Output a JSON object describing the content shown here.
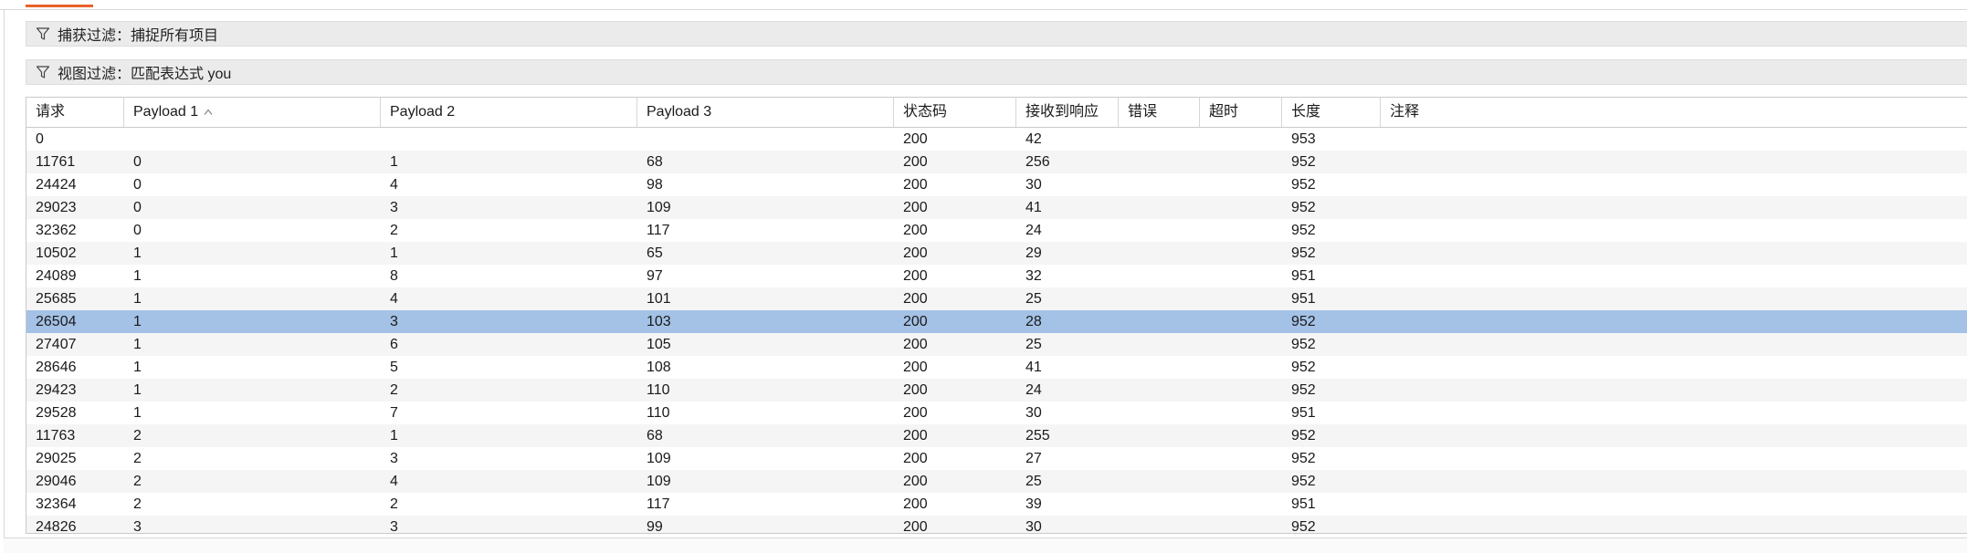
{
  "capture_filter": {
    "label": "捕获过滤：",
    "value": "捕捉所有项目"
  },
  "view_filter": {
    "label": "视图过滤：",
    "value": "匹配表达式 you"
  },
  "table": {
    "headers": [
      "请求",
      "Payload 1",
      "Payload 2",
      "Payload 3",
      "状态码",
      "接收到响应",
      "错误",
      "超时",
      "长度",
      "注释"
    ],
    "sorted_column": "Payload 1",
    "sort_direction": "ascending",
    "selected_row": 8,
    "selection_color": "#a4c1e6",
    "rows": [
      [
        "0",
        "",
        "",
        "",
        "200",
        "42",
        "",
        "",
        "953",
        ""
      ],
      [
        "11761",
        "0",
        "1",
        "68",
        "200",
        "256",
        "",
        "",
        "952",
        ""
      ],
      [
        "24424",
        "0",
        "4",
        "98",
        "200",
        "30",
        "",
        "",
        "952",
        ""
      ],
      [
        "29023",
        "0",
        "3",
        "109",
        "200",
        "41",
        "",
        "",
        "952",
        ""
      ],
      [
        "32362",
        "0",
        "2",
        "117",
        "200",
        "24",
        "",
        "",
        "952",
        ""
      ],
      [
        "10502",
        "1",
        "1",
        "65",
        "200",
        "29",
        "",
        "",
        "952",
        ""
      ],
      [
        "24089",
        "1",
        "8",
        "97",
        "200",
        "32",
        "",
        "",
        "951",
        ""
      ],
      [
        "25685",
        "1",
        "4",
        "101",
        "200",
        "25",
        "",
        "",
        "951",
        ""
      ],
      [
        "26504",
        "1",
        "3",
        "103",
        "200",
        "28",
        "",
        "",
        "952",
        ""
      ],
      [
        "27407",
        "1",
        "6",
        "105",
        "200",
        "25",
        "",
        "",
        "952",
        ""
      ],
      [
        "28646",
        "1",
        "5",
        "108",
        "200",
        "41",
        "",
        "",
        "952",
        ""
      ],
      [
        "29423",
        "1",
        "2",
        "110",
        "200",
        "24",
        "",
        "",
        "952",
        ""
      ],
      [
        "29528",
        "1",
        "7",
        "110",
        "200",
        "30",
        "",
        "",
        "951",
        ""
      ],
      [
        "11763",
        "2",
        "1",
        "68",
        "200",
        "255",
        "",
        "",
        "952",
        ""
      ],
      [
        "29025",
        "2",
        "3",
        "109",
        "200",
        "27",
        "",
        "",
        "952",
        ""
      ],
      [
        "29046",
        "2",
        "4",
        "109",
        "200",
        "25",
        "",
        "",
        "952",
        ""
      ],
      [
        "32364",
        "2",
        "2",
        "117",
        "200",
        "39",
        "",
        "",
        "951",
        ""
      ],
      [
        "24826",
        "3",
        "3",
        "99",
        "200",
        "30",
        "",
        "",
        "952",
        ""
      ]
    ]
  }
}
